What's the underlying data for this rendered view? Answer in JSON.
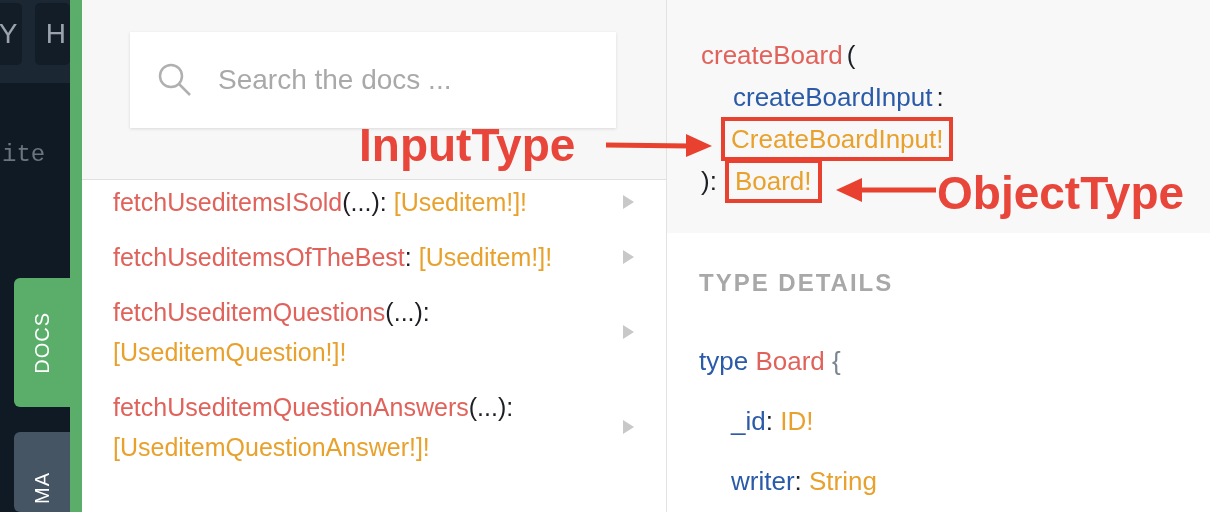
{
  "editor": {
    "tabs": [
      {
        "label": "Y"
      },
      {
        "label": "H"
      }
    ],
    "code_fragment": "ite"
  },
  "side_tabs": [
    {
      "label": "DOCS",
      "selected": true
    },
    {
      "label": "MA",
      "selected": false
    }
  ],
  "search": {
    "placeholder": "Search the docs ..."
  },
  "fields": [
    {
      "name": "fetchUseditemsISold",
      "args": "(...)",
      "colon": ":",
      "type": "[Useditem!]!"
    },
    {
      "name": "fetchUseditemsOfTheBest",
      "colon": ":",
      "type": "[Useditem!]!"
    },
    {
      "name": "fetchUseditemQuestions",
      "args": "(...)",
      "colon": ":",
      "type": "[UseditemQuestion!]!"
    },
    {
      "name": "fetchUseditemQuestionAnswers",
      "args": "(...)",
      "colon": ":",
      "type": "[UseditemQuestionAnswer!]!"
    }
  ],
  "signature": [
    [
      {
        "kind": "name",
        "text": "createBoard",
        "highlighted": false
      },
      {
        "kind": "punct",
        "text": "(",
        "highlighted": false
      }
    ],
    [
      {
        "kind": "arg",
        "text": "createBoardInput",
        "highlighted": false
      },
      {
        "kind": "punct",
        "text": ":",
        "highlighted": false
      }
    ],
    [
      {
        "kind": "type",
        "text": "CreateBoardInput!",
        "highlighted": true
      }
    ],
    [
      {
        "kind": "punct",
        "text": "):",
        "highlighted": false
      },
      {
        "kind": "type",
        "text": "Board!",
        "highlighted": true
      }
    ]
  ],
  "type_details": {
    "heading": "TYPE DETAILS",
    "keyword": "type",
    "name": "Board",
    "brace": "{",
    "fields": [
      {
        "name": "_id",
        "colon": ":",
        "type": "ID!"
      },
      {
        "name": "writer",
        "colon": ":",
        "type": "String"
      }
    ]
  },
  "annotations": [
    {
      "label": "InputType"
    },
    {
      "label": "ObjectType"
    }
  ]
}
